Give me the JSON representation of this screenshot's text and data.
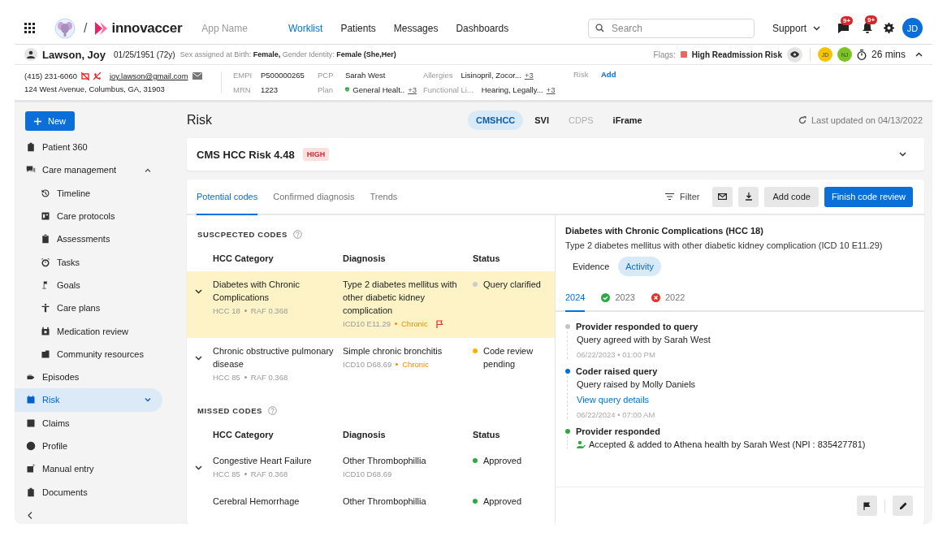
{
  "nav": {
    "app_name": "App Name",
    "brand": "innovaccer",
    "separator": "/",
    "links": [
      {
        "label": "Worklist",
        "selected": true
      },
      {
        "label": "Patients",
        "selected": false
      },
      {
        "label": "Messages",
        "selected": false
      },
      {
        "label": "Dashboards",
        "selected": false
      }
    ],
    "search": {
      "placeholder": "Search"
    },
    "support": "Support",
    "notifications": [
      {
        "count": "9+"
      },
      {
        "count": "9+"
      }
    ],
    "user": "JD"
  },
  "patient": {
    "name": "Lawson, Joy",
    "dob": "01/25/1951 (72y)",
    "identity": "Sex assigned at Birth: **Female,** Gender Identity: **Female (She,Her)**",
    "flags_label": "Flags:",
    "flag": "High Readmission Risk",
    "team": [
      {
        "initials": "JD",
        "color": "#f5c400"
      },
      {
        "initials": "NJ",
        "color": "#7cc422"
      }
    ],
    "timer": "26 mins"
  },
  "contact": {
    "phone": "(415) 231-6060",
    "email": "joy.lawson@gmail.com",
    "address": "124 West Avenue, Columbus, GA, 31903"
  },
  "fields": [
    {
      "label": "EMPI",
      "value": "P500000265",
      "kind": "plain"
    },
    {
      "label": "MRN",
      "value": "1223",
      "kind": "plain"
    },
    {
      "label": "PCP",
      "value": "Sarah West",
      "kind": "plain"
    },
    {
      "label": "Plan",
      "value": "General Healt..",
      "more": "+3",
      "kind": "verified"
    },
    {
      "label": "Allergies",
      "value": "Lisinopril, Zocor...",
      "more": "+3",
      "kind": "plain"
    },
    {
      "label": "Functional Li...",
      "value": "Hearing, Legally...",
      "more": "+3",
      "kind": "plain"
    }
  ],
  "risk_field": {
    "label": "Risk",
    "action": "Add"
  },
  "sidebar": {
    "new_button": "New",
    "items": [
      {
        "label": "Patient 360",
        "selected": false
      },
      {
        "label": "Care management",
        "selected": false,
        "expanded": true,
        "children": [
          {
            "label": "Timeline",
            "selected": false
          },
          {
            "label": "Care protocols",
            "selected": false
          },
          {
            "label": "Assessments",
            "selected": false
          },
          {
            "label": "Tasks",
            "selected": false
          },
          {
            "label": "Goals",
            "selected": false
          },
          {
            "label": "Care plans",
            "selected": false
          },
          {
            "label": "Medication review",
            "selected": false
          },
          {
            "label": "Community resources",
            "selected": false
          }
        ]
      },
      {
        "label": "Episodes",
        "selected": false
      },
      {
        "label": "Risk",
        "selected": true,
        "expanded": false
      },
      {
        "label": "Claims",
        "selected": false
      },
      {
        "label": "Profile",
        "selected": false
      },
      {
        "label": "Manual entry",
        "selected": false
      },
      {
        "label": "Documents",
        "selected": false
      }
    ]
  },
  "main": {
    "title": "Risk",
    "sources": [
      {
        "label": "CMSHCC",
        "selected": true,
        "disabled": false
      },
      {
        "label": "SVI",
        "selected": false,
        "disabled": false
      },
      {
        "label": "CDPS",
        "selected": false,
        "disabled": true
      },
      {
        "label": "iFrame",
        "selected": false,
        "disabled": false
      }
    ],
    "last_updated": "Last updated on 04/13/2022",
    "risk_card": {
      "title": "CMS HCC Risk 4.48",
      "badge": "HIGH",
      "expanded": false
    },
    "code_tabs": [
      {
        "label": "Potential codes",
        "selected": true
      },
      {
        "label": "Confirmed diagnosis",
        "selected": false
      },
      {
        "label": "Trends",
        "selected": false
      }
    ],
    "actions": {
      "filter": "Filter",
      "add": "Add code",
      "finish": "Finish code review"
    },
    "sections": [
      {
        "title": "SUSCPECTED CODES",
        "columns": [
          "HCC Category",
          "Diagnosis",
          "Status"
        ],
        "rows": [
          {
            "category": "Diabetes with Chronic Complications",
            "hcc": "HCC 18",
            "raf": "RAF 0.368",
            "diagnosis": "Type 2 diabetes mellitus with other diabetic kidney complication",
            "icd": "ICD10 E11.29",
            "tag": "Chronic",
            "flagged": true,
            "status": "Query clarified",
            "color": "#c8ccd2",
            "selected": true,
            "expandable": true
          },
          {
            "category": "Chronic obstructive pulmonary disease",
            "hcc": "HCC 85",
            "raf": "RAF 0.368",
            "diagnosis": "Simple chronic bronchitis",
            "icd": "ICD10 D68.69",
            "tag": "Chronic",
            "flagged": false,
            "status": "Code review pending",
            "color": "#f5b400",
            "selected": false,
            "expandable": true
          }
        ]
      },
      {
        "title": "MISSED CODES",
        "columns": [
          "HCC Category",
          "Diagnosis",
          "Status"
        ],
        "rows": [
          {
            "category": "Congestive Heart Failure",
            "hcc": "HCC 85",
            "raf": "RAF 0.368",
            "diagnosis": "Other Thrombophillia",
            "icd": "ICD10 D68.69",
            "flagged": false,
            "status": "Approved",
            "color": "#2ea843",
            "selected": false,
            "expandable": true
          },
          {
            "category": "Cerebral Hemorrhage",
            "diagnosis": "Other Thrombophillia",
            "flagged": false,
            "status": "Approved",
            "color": "#2ea843",
            "selected": false,
            "expandable": false
          }
        ]
      }
    ],
    "detail": {
      "title": "Diabetes with Chronic Complications (HCC 18)",
      "subtitle": "Type 2 diabetes mellitus with other diabetic kidney complication (ICD 10 E11.29)",
      "tabs": [
        {
          "label": "Evidence",
          "selected": false
        },
        {
          "label": "Activity",
          "selected": true
        }
      ],
      "years": [
        {
          "label": "2024",
          "selected": true,
          "kind": "plain"
        },
        {
          "label": "2023",
          "selected": false,
          "kind": "passed"
        },
        {
          "label": "2022",
          "selected": false,
          "kind": "failed"
        }
      ],
      "activities": [
        {
          "title": "Provider responded to query",
          "color": "#c4c4c4",
          "text": "Query agreed with by Sarah West",
          "time": "06/22/2023 • 01:00 PM",
          "kind": "note"
        },
        {
          "title": "Coder raised query",
          "color": "#0070dd",
          "text": "Query raised by Molly Daniels",
          "link": "View query details",
          "time": "06/22/2024 • 07:00 AM",
          "kind": "note"
        },
        {
          "title": "Provider responded",
          "color": "#2ea843",
          "text": "Accepted & added to Athena health by Sarah West (NPI : 835427781)",
          "kind": "accepted"
        }
      ]
    }
  }
}
